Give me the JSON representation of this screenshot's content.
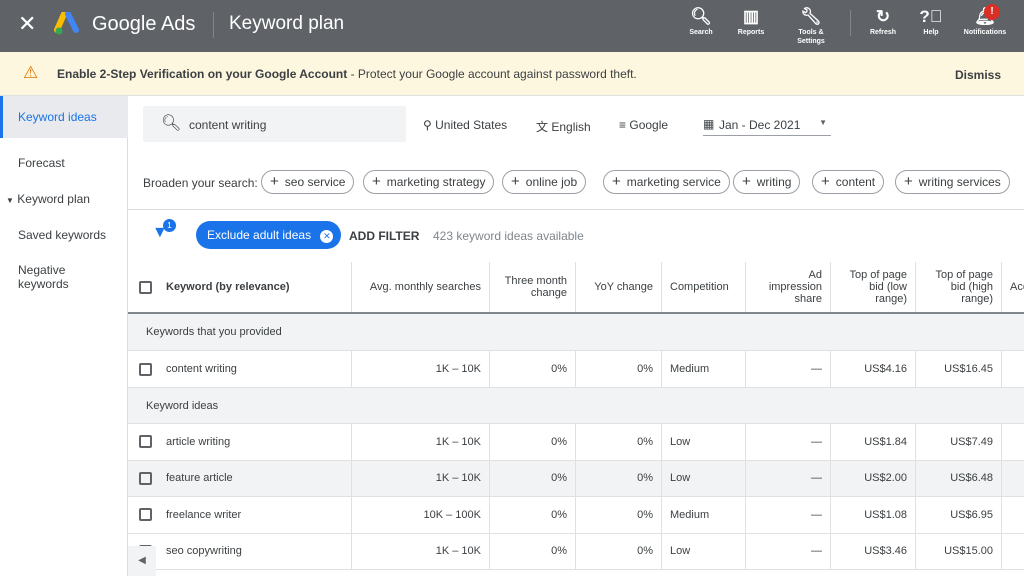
{
  "header": {
    "brand": "Google Ads",
    "page_title": "Keyword plan",
    "tools": [
      {
        "label": "Search",
        "icon": "search-icon",
        "g": "🔍︎"
      },
      {
        "label": "Reports",
        "icon": "reports-icon",
        "g": "▥"
      },
      {
        "label": "Tools & Settings",
        "icon": "wrench-icon",
        "g": "🔧︎"
      },
      {
        "label": "Refresh",
        "icon": "refresh-icon",
        "g": "↻"
      },
      {
        "label": "Help",
        "icon": "help-icon",
        "g": "?⃝"
      },
      {
        "label": "Notifications",
        "icon": "bell-icon",
        "g": "🔔︎"
      }
    ],
    "notification_badge": "!"
  },
  "banner": {
    "title": "Enable 2-Step Verification on your Google Account",
    "text": " - Protect your Google account against password theft.",
    "dismiss": "Dismiss"
  },
  "sidebar": {
    "items": [
      "Keyword ideas",
      "Forecast",
      "Keyword plan",
      "Saved keywords",
      "Negative keywords"
    ]
  },
  "search": {
    "value": "content writing",
    "location": "United States",
    "language": "English",
    "network": "Google",
    "date_range": "Jan - Dec 2021"
  },
  "broaden": {
    "label": "Broaden your search:",
    "chips": [
      "seo service",
      "marketing strategy",
      "online job",
      "marketing service",
      "writing",
      "content",
      "writing services"
    ]
  },
  "filters": {
    "count": "1",
    "chip": "Exclude adult ideas",
    "add": "ADD FILTER",
    "available": "423 keyword ideas available"
  },
  "table": {
    "headers": [
      "Keyword (by relevance)",
      "Avg. monthly searches",
      "Three month change",
      "YoY change",
      "Competition",
      "Ad impression share",
      "Top of page bid (low range)",
      "Top of page bid (high range)",
      "Acc"
    ],
    "group1": "Keywords that you provided",
    "group2": "Keyword ideas",
    "provided": [
      [
        "content writing",
        "1K – 10K",
        "0%",
        "0%",
        "Medium",
        "—",
        "US$4.16",
        "US$16.45"
      ]
    ],
    "ideas": [
      [
        "article writing",
        "1K – 10K",
        "0%",
        "0%",
        "Low",
        "—",
        "US$1.84",
        "US$7.49"
      ],
      [
        "feature article",
        "1K – 10K",
        "0%",
        "0%",
        "Low",
        "—",
        "US$2.00",
        "US$6.48"
      ],
      [
        "freelance writer",
        "10K – 100K",
        "0%",
        "0%",
        "Medium",
        "—",
        "US$1.08",
        "US$6.95"
      ],
      [
        "seo copywriting",
        "1K – 10K",
        "0%",
        "0%",
        "Low",
        "—",
        "US$3.46",
        "US$15.00"
      ]
    ]
  }
}
